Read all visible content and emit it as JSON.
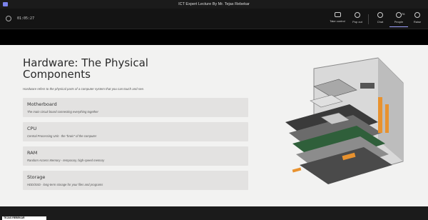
{
  "window": {
    "title": "ICT Expert Lecture By Mr. Tejas Rebekar"
  },
  "toolbar": {
    "timer": "01:05:27",
    "buttons": [
      {
        "label": "Take control",
        "icon": "screen-share-icon"
      },
      {
        "label": "Pop out",
        "icon": "pop-out-icon"
      },
      {
        "label": "Chat",
        "icon": "chat-icon"
      },
      {
        "label": "People",
        "icon": "people-icon",
        "count": "76"
      },
      {
        "label": "Raise",
        "icon": "raise-hand-icon"
      }
    ]
  },
  "slide": {
    "title": "Hardware: The Physical Components",
    "intro": "Hardware refers to the physical parts of a computer system that you can touch and see.",
    "cards": [
      {
        "heading": "Motherboard",
        "desc": "The main circuit board connecting everything together"
      },
      {
        "heading": "CPU",
        "desc": "Central Processing Unit - the \"brain\" of the computer"
      },
      {
        "heading": "RAM",
        "desc": "Random Access Memory - temporary, high-speed memory"
      },
      {
        "heading": "Storage",
        "desc": "HDD/SSD - long-term storage for your files and programs"
      }
    ]
  },
  "bottombar": {
    "tag": "TEJAS REBEKAR"
  },
  "colors": {
    "accent": "#9ea2ff",
    "slide_bg": "#f2f2f1",
    "card_bg": "#e3e2e1",
    "toolbar_bg": "#141414"
  }
}
